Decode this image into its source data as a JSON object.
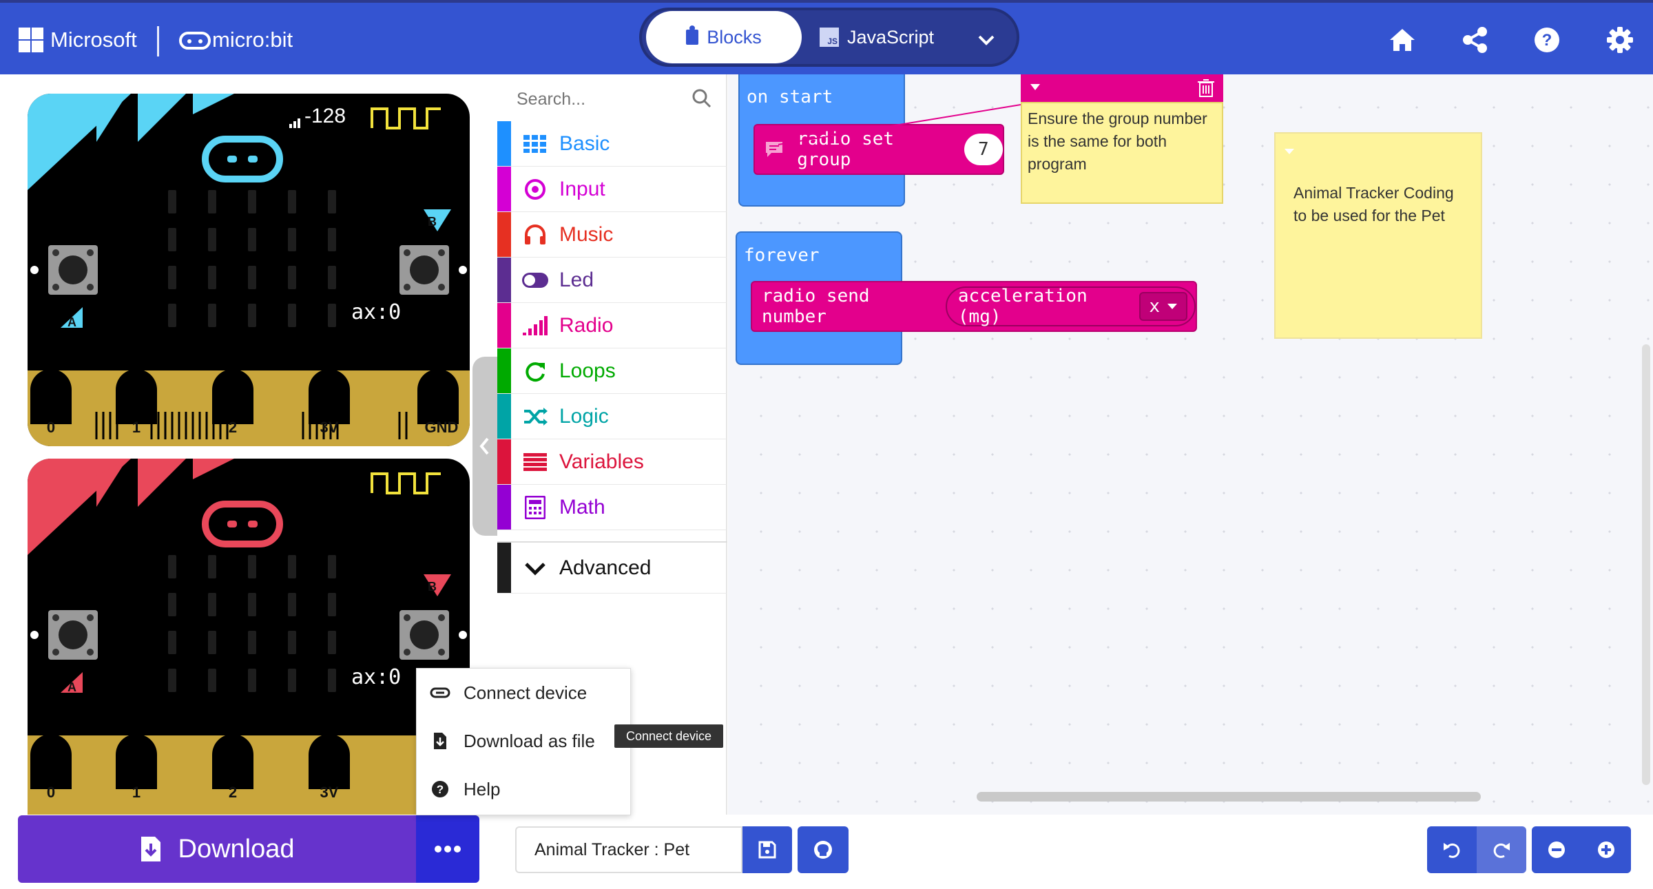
{
  "header": {
    "brand_name": "Microsoft",
    "product_name": "micro:bit",
    "tabs": [
      {
        "label": "Blocks"
      },
      {
        "label": "JavaScript"
      }
    ],
    "js_badge": "JS",
    "icons": [
      "home-icon",
      "share-icon",
      "help-icon",
      "settings-icon"
    ]
  },
  "simulator": {
    "signal_value": "-128",
    "board1": {
      "accent": "#5AD4F5",
      "ax_label": "ax:0",
      "btn_a": "A",
      "btn_b": "B",
      "pins": [
        "0",
        "1",
        "2",
        "3V",
        "GND"
      ]
    },
    "board2": {
      "accent": "#E9485A",
      "ax_label": "ax:0",
      "btn_a": "A",
      "btn_b": "B",
      "pins": [
        "0",
        "1",
        "2",
        "3V"
      ]
    }
  },
  "toolbox": {
    "search_placeholder": "Search...",
    "categories": [
      {
        "label": "Basic",
        "color": "#1E90FF"
      },
      {
        "label": "Input",
        "color": "#D400D4"
      },
      {
        "label": "Music",
        "color": "#E63022"
      },
      {
        "label": "Led",
        "color": "#5C2D91"
      },
      {
        "label": "Radio",
        "color": "#E3008C"
      },
      {
        "label": "Loops",
        "color": "#00AA00"
      },
      {
        "label": "Logic",
        "color": "#00A4A6"
      },
      {
        "label": "Variables",
        "color": "#DC143C"
      },
      {
        "label": "Math",
        "color": "#9400D3"
      },
      {
        "label": "Advanced",
        "color": "#1E1E1E"
      }
    ]
  },
  "workspace": {
    "on_start_label": "on start",
    "radio_set_group_label": "radio set group",
    "radio_group_value": "7",
    "forever_label": "forever",
    "radio_send_number_label": "radio send number",
    "acceleration_label": "acceleration (mg)",
    "axis_value": "x",
    "note1_text": "Ensure the group number is the same for both program",
    "note2_text": "Animal Tracker Coding to be used for the Pet"
  },
  "bottom": {
    "download_label": "Download",
    "project_name": "Animal Tracker : Pet"
  },
  "download_menu": {
    "items": [
      {
        "label": "Connect device",
        "icon": "connect-icon"
      },
      {
        "label": "Download as file",
        "icon": "download-file-icon"
      },
      {
        "label": "Help",
        "icon": "help-icon"
      }
    ],
    "tooltip": "Connect device"
  }
}
